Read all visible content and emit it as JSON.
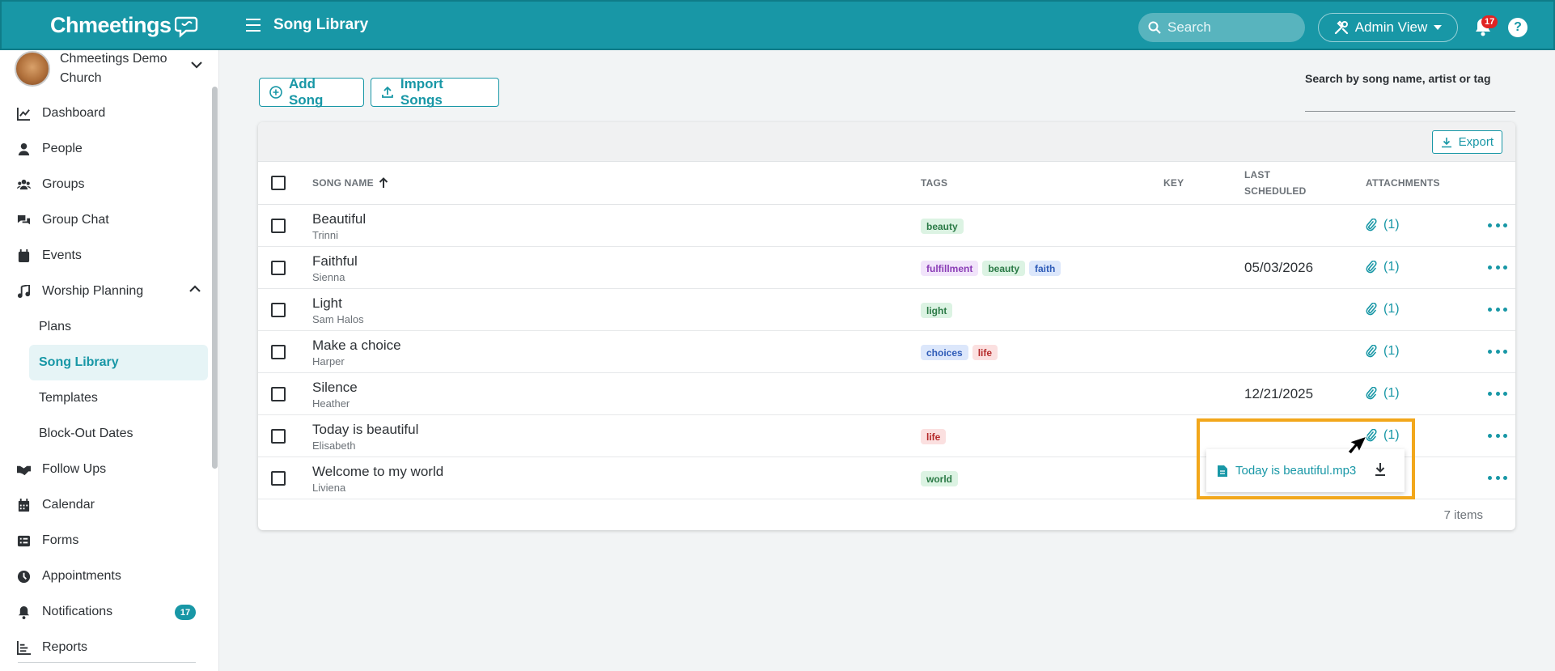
{
  "header": {
    "logo": "Chmeetings",
    "page_title": "Song Library",
    "search_placeholder": "Search",
    "admin_view_label": "Admin View",
    "notification_count": "17",
    "help_label": "?"
  },
  "sidebar": {
    "church_name": "Chmeetings Demo Church",
    "items": [
      {
        "label": "Dashboard",
        "icon": "chart-line-icon"
      },
      {
        "label": "People",
        "icon": "person-icon"
      },
      {
        "label": "Groups",
        "icon": "groups-icon"
      },
      {
        "label": "Group Chat",
        "icon": "chat-icon"
      },
      {
        "label": "Events",
        "icon": "calendar-icon"
      },
      {
        "label": "Worship Planning",
        "icon": "music-note-icon"
      },
      {
        "label": "Follow Ups",
        "icon": "handshake-icon"
      },
      {
        "label": "Calendar",
        "icon": "calendar-grid-icon"
      },
      {
        "label": "Forms",
        "icon": "form-list-icon"
      },
      {
        "label": "Appointments",
        "icon": "clock-icon"
      },
      {
        "label": "Notifications",
        "icon": "bell-icon",
        "badge": "17"
      },
      {
        "label": "Reports",
        "icon": "bar-chart-icon"
      }
    ],
    "worship_sub": [
      "Plans",
      "Song Library",
      "Templates",
      "Block-Out Dates"
    ]
  },
  "toolbar": {
    "add_song_label": "Add Song",
    "import_songs_label": "Import Songs",
    "search_label": "Search by song name, artist or tag",
    "export_label": "Export"
  },
  "table": {
    "headers": {
      "song_name": "SONG NAME",
      "tags": "TAGS",
      "key": "KEY",
      "last_scheduled_1": "LAST",
      "last_scheduled_2": "SCHEDULED",
      "attachments": "ATTACHMENTS"
    },
    "rows": [
      {
        "name": "Beautiful",
        "artist": "Trinni",
        "tags": [
          {
            "text": "beauty",
            "color": "green"
          }
        ],
        "last_scheduled": "",
        "attachments": "(1)"
      },
      {
        "name": "Faithful",
        "artist": "Sienna",
        "tags": [
          {
            "text": "fulfillment",
            "color": "purple"
          },
          {
            "text": "beauty",
            "color": "green"
          },
          {
            "text": "faith",
            "color": "blue"
          }
        ],
        "last_scheduled": "05/03/2026",
        "attachments": "(1)"
      },
      {
        "name": "Light",
        "artist": "Sam Halos",
        "tags": [
          {
            "text": "light",
            "color": "green"
          }
        ],
        "last_scheduled": "",
        "attachments": "(1)"
      },
      {
        "name": "Make a choice",
        "artist": "Harper",
        "tags": [
          {
            "text": "choices",
            "color": "blue"
          },
          {
            "text": "life",
            "color": "red"
          }
        ],
        "last_scheduled": "",
        "attachments": "(1)"
      },
      {
        "name": "Silence",
        "artist": "Heather",
        "tags": [],
        "last_scheduled": "12/21/2025",
        "attachments": "(1)"
      },
      {
        "name": "Today is beautiful",
        "artist": "Elisabeth",
        "tags": [
          {
            "text": "life",
            "color": "red"
          }
        ],
        "last_scheduled": "",
        "attachments": "(1)"
      },
      {
        "name": "Welcome to my world",
        "artist": "Liviena",
        "tags": [
          {
            "text": "world",
            "color": "green"
          }
        ],
        "last_scheduled": "",
        "attachments": ""
      }
    ],
    "item_count": "7 items"
  },
  "attachment_popup": {
    "file_name": "Today is beautiful.mp3"
  },
  "colors": {
    "brand": "#1897a6",
    "highlight": "#f2a71b"
  }
}
